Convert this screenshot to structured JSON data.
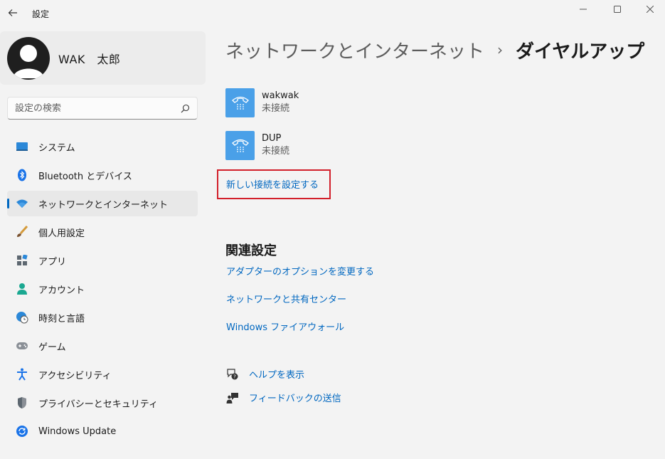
{
  "window": {
    "title": "設定"
  },
  "user": {
    "name": "WAK　太郎"
  },
  "search": {
    "placeholder": "設定の検索"
  },
  "sidebar": {
    "items": [
      {
        "label": "システム",
        "icon": "system-icon",
        "active": false
      },
      {
        "label": "Bluetooth とデバイス",
        "icon": "bluetooth-icon",
        "active": false
      },
      {
        "label": "ネットワークとインターネット",
        "icon": "wifi-icon",
        "active": true
      },
      {
        "label": "個人用設定",
        "icon": "brush-icon",
        "active": false
      },
      {
        "label": "アプリ",
        "icon": "apps-icon",
        "active": false
      },
      {
        "label": "アカウント",
        "icon": "account-icon",
        "active": false
      },
      {
        "label": "時刻と言語",
        "icon": "globe-clock-icon",
        "active": false
      },
      {
        "label": "ゲーム",
        "icon": "gamepad-icon",
        "active": false
      },
      {
        "label": "アクセシビリティ",
        "icon": "accessibility-icon",
        "active": false
      },
      {
        "label": "プライバシーとセキュリティ",
        "icon": "shield-icon",
        "active": false
      },
      {
        "label": "Windows Update",
        "icon": "update-icon",
        "active": false
      }
    ]
  },
  "breadcrumb": {
    "parent": "ネットワークとインターネット",
    "separator": "›",
    "current": "ダイヤルアップ"
  },
  "connections": [
    {
      "name": "wakwak",
      "status": "未接続",
      "icon": "phone-icon"
    },
    {
      "name": "DUP",
      "status": "未接続",
      "icon": "phone-icon"
    }
  ],
  "new_connection": {
    "label": "新しい接続を設定する"
  },
  "related": {
    "title": "関連設定",
    "links": [
      "アダプターのオプションを変更する",
      "ネットワークと共有センター",
      "Windows ファイアウォール"
    ]
  },
  "help": {
    "show_help": "ヘルプを表示",
    "feedback": "フィードバックの送信"
  },
  "colors": {
    "accent": "#0067c0",
    "highlight_frame": "#d21f2a",
    "connection_icon_bg": "#4aa0e8"
  }
}
